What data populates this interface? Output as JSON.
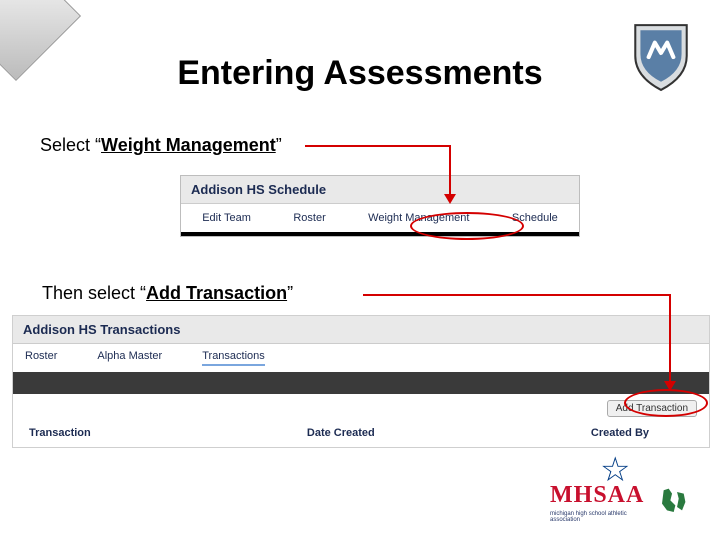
{
  "title": "Entering Assessments",
  "instr1": {
    "pre": "Select “",
    "link": "Weight Management",
    "post": "”"
  },
  "instr2": {
    "pre": "Then select “",
    "link": "Add Transaction",
    "post": "”"
  },
  "shot1": {
    "header": "Addison HS Schedule",
    "tabs": [
      "Edit Team",
      "Roster",
      "Weight Management",
      "Schedule"
    ]
  },
  "shot2": {
    "header": "Addison HS Transactions",
    "tabs": [
      "Roster",
      "Alpha Master",
      "Transactions"
    ],
    "active_tab_index": 2,
    "button": "Add Transaction",
    "columns": [
      "Transaction",
      "Date Created",
      "Created By"
    ]
  },
  "logo": {
    "text": "MHSAA",
    "sub": "michigan high school athletic association"
  },
  "colors": {
    "red": "#d40000",
    "navy": "#1c2b52",
    "brand_red": "#c8102e"
  }
}
